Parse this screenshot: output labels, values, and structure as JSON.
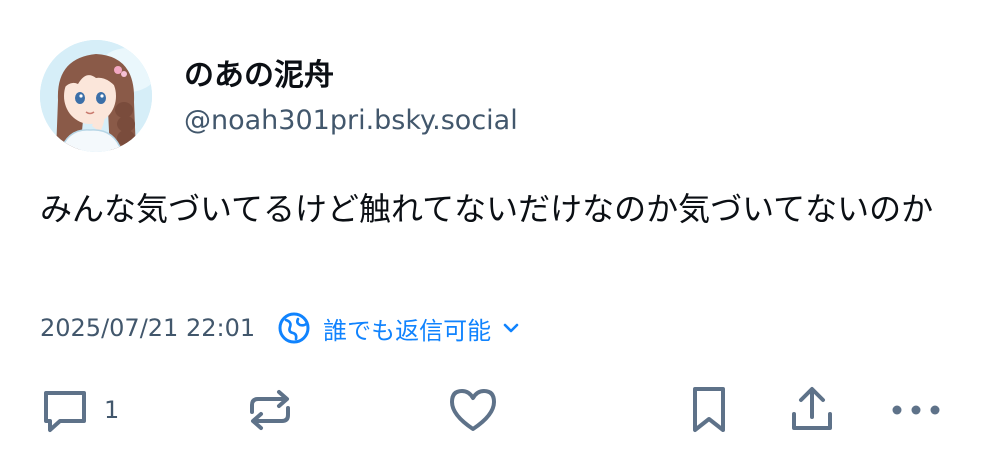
{
  "post": {
    "author": {
      "display_name": "のあの泥舟",
      "handle": "@noah301pri.bsky.social"
    },
    "text": "みんな気づいてるけど触れてないだけなのか気づいてないのか",
    "timestamp": "2025/07/21 22:01",
    "reply_setting_label": "誰でも返信可能"
  },
  "actions": {
    "reply_count": "1"
  },
  "colors": {
    "accent": "#1083fe",
    "icon_gray": "#5e7289",
    "secondary_text": "#42576c"
  },
  "icons": {
    "reply": "speech-bubble-icon",
    "repost": "repost-arrows-icon",
    "like": "heart-icon",
    "bookmark": "bookmark-icon",
    "share": "share-upload-icon",
    "more": "ellipsis-icon",
    "reply_setting": "earth-globe-icon",
    "dropdown": "chevron-down-icon"
  }
}
